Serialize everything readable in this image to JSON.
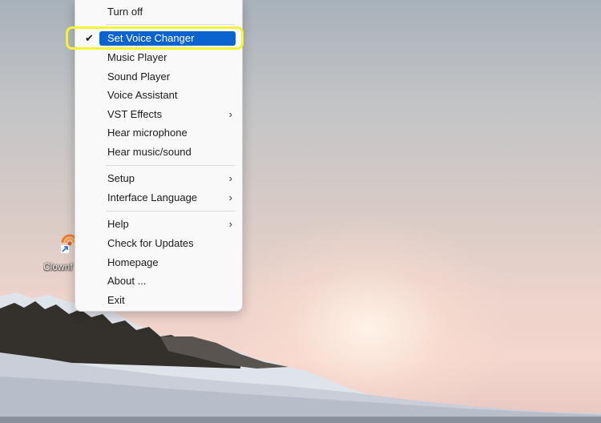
{
  "desktop": {
    "icon_label": "Clownf",
    "icon_name": "clownfish-voice-changer-shortcut-icon"
  },
  "menu": {
    "items": [
      {
        "label": "Turn off",
        "checked": false,
        "submenu": false,
        "selected": false
      },
      {
        "label": "Set Voice Changer",
        "checked": true,
        "submenu": false,
        "selected": true
      },
      {
        "label": "Music Player",
        "checked": false,
        "submenu": false,
        "selected": false
      },
      {
        "label": "Sound Player",
        "checked": false,
        "submenu": false,
        "selected": false
      },
      {
        "label": "Voice Assistant",
        "checked": false,
        "submenu": false,
        "selected": false
      },
      {
        "label": "VST Effects",
        "checked": false,
        "submenu": true,
        "selected": false
      },
      {
        "label": "Hear microphone",
        "checked": false,
        "submenu": false,
        "selected": false
      },
      {
        "label": "Hear music/sound",
        "checked": false,
        "submenu": false,
        "selected": false
      },
      {
        "label": "Setup",
        "checked": false,
        "submenu": true,
        "selected": false
      },
      {
        "label": "Interface Language",
        "checked": false,
        "submenu": true,
        "selected": false
      },
      {
        "label": "Help",
        "checked": false,
        "submenu": true,
        "selected": false
      },
      {
        "label": "Check for Updates",
        "checked": false,
        "submenu": false,
        "selected": false
      },
      {
        "label": "Homepage",
        "checked": false,
        "submenu": false,
        "selected": false
      },
      {
        "label": "About ...",
        "checked": false,
        "submenu": false,
        "selected": false
      },
      {
        "label": "Exit",
        "checked": false,
        "submenu": false,
        "selected": false
      }
    ],
    "check_glyph": "✔",
    "submenu_glyph": "›"
  },
  "colors": {
    "highlight": "#0a63cf",
    "callout": "#f4f436"
  }
}
